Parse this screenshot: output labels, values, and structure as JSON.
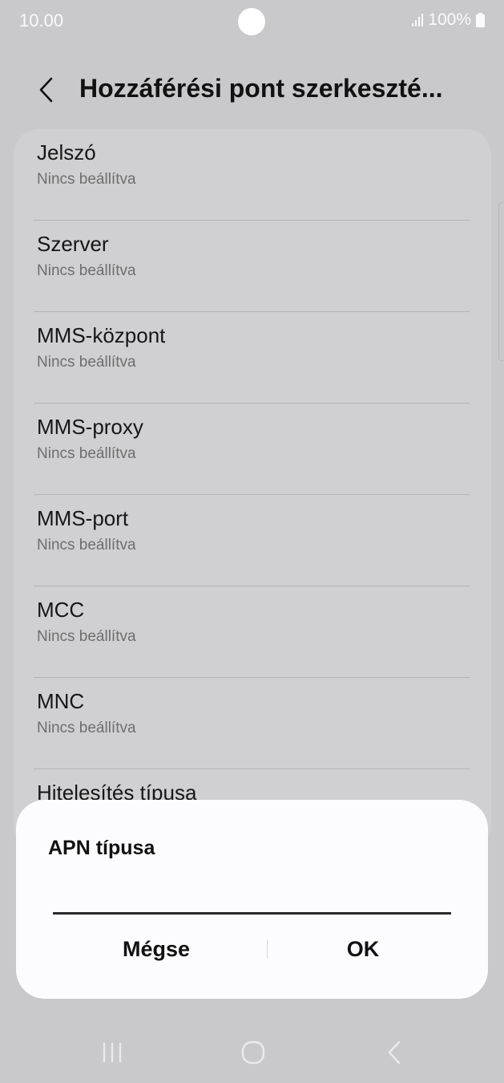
{
  "status_bar": {
    "time": "10.00",
    "battery": "100%",
    "icons": [
      "signal-icon",
      "battery-icon"
    ]
  },
  "header": {
    "title": "Hozzáférési pont szerkeszté...",
    "back_icon": "chevron-left-icon"
  },
  "settings": {
    "items": [
      {
        "title": "Jelszó",
        "value": "Nincs beállítva"
      },
      {
        "title": "Szerver",
        "value": "Nincs beállítva"
      },
      {
        "title": "MMS-központ",
        "value": "Nincs beállítva"
      },
      {
        "title": "MMS-proxy",
        "value": "Nincs beállítva"
      },
      {
        "title": "MMS-port",
        "value": "Nincs beállítva"
      },
      {
        "title": "MCC",
        "value": "Nincs beállítva"
      },
      {
        "title": "MNC",
        "value": "Nincs beállítva"
      },
      {
        "title": "Hitelesítés típusa",
        "value": ""
      }
    ]
  },
  "dialog": {
    "title": "APN típusa",
    "input_value": "",
    "cancel_label": "Mégse",
    "ok_label": "OK"
  },
  "nav_bar": {
    "icons": [
      "recents-icon",
      "home-icon",
      "back-icon"
    ]
  },
  "colors": {
    "background_dimmed": "#c9c9cb",
    "card": "#d0d0d2",
    "dialog": "#fcfcfe",
    "text_primary": "#161616",
    "text_secondary": "#6e6e6e"
  }
}
